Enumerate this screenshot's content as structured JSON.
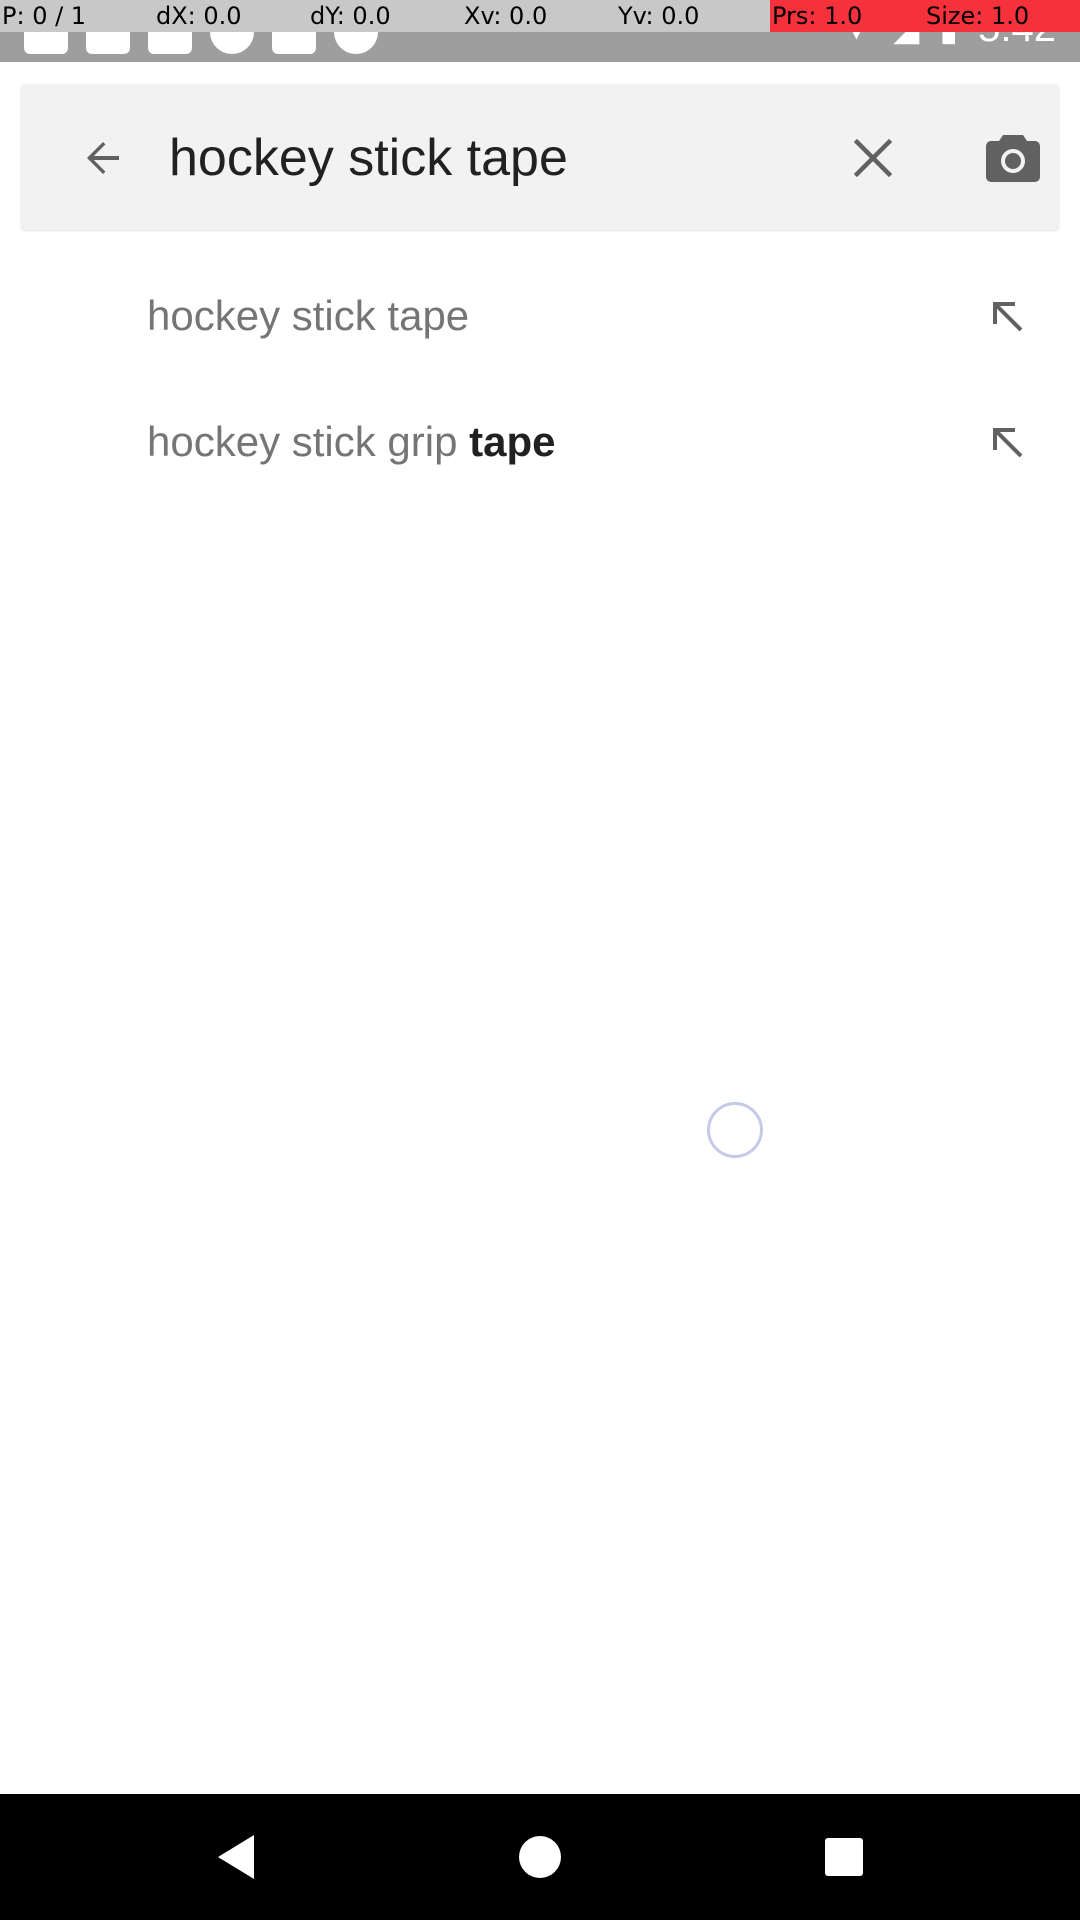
{
  "pointer_overlay": {
    "cells": [
      "P: 0 / 1",
      "dX: 0.0",
      "dY: 0.0",
      "Xv: 0.0",
      "Yv: 0.0",
      "Prs: 1.0",
      "Size: 1.0"
    ]
  },
  "status_bar": {
    "time": "5:42",
    "icons": [
      "app-notification-icon",
      "shopping-bag-icon",
      "shopping-bag-icon",
      "pie-chart-icon",
      "text-icon",
      "circle-icon",
      "wifi-icon",
      "signal-icon",
      "battery-icon"
    ]
  },
  "search": {
    "query": "hockey stick tape",
    "back_icon": "arrow-left-icon",
    "clear_icon": "close-icon",
    "camera_icon": "camera-icon"
  },
  "suggestions": [
    {
      "prefix": "hockey stick tape",
      "suffix": "",
      "fill_icon": "arrow-up-left-icon"
    },
    {
      "prefix": "hockey stick grip ",
      "suffix": "tape",
      "fill_icon": "arrow-up-left-icon"
    }
  ],
  "nav_bar": {
    "icons": [
      "nav-back-icon",
      "nav-home-icon",
      "nav-recents-icon"
    ]
  },
  "colors": {
    "overlay_gray": "#c8c8c8",
    "overlay_red": "#f5313c",
    "search_bg": "#f2f2f2",
    "query_text": "#212121",
    "suggestion_text": "#757575",
    "icon_gray": "#616161",
    "spinner": "#c5cae9"
  }
}
